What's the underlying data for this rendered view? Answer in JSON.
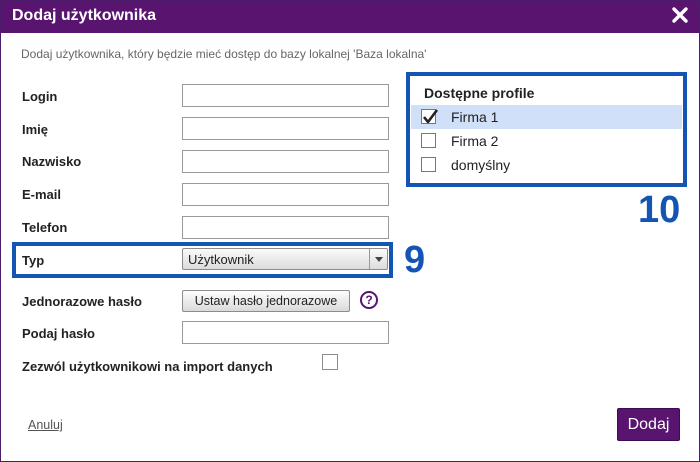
{
  "dialog": {
    "title": "Dodaj użytkownika",
    "close_icon": "close-icon",
    "description": "Dodaj użytkownika, który będzie mieć dostęp do bazy lokalnej 'Baza lokalna'"
  },
  "form": {
    "login_label": "Login",
    "login_value": "",
    "first_name_label": "Imię",
    "first_name_value": "",
    "last_name_label": "Nazwisko",
    "last_name_value": "",
    "email_label": "E-mail",
    "email_value": "",
    "phone_label": "Telefon",
    "phone_value": "",
    "type_label": "Typ",
    "type_value": "Użytkownik",
    "one_time_password_label": "Jednorazowe hasło",
    "one_time_password_button": "Ustaw hasło jednorazowe",
    "help_symbol": "?",
    "password_label": "Podaj hasło",
    "password_value": "",
    "allow_import_label": "Zezwól użytkownikowi na import danych",
    "allow_import_checked": false
  },
  "profiles": {
    "title": "Dostępne profile",
    "items": [
      {
        "label": "Firma 1",
        "checked": true,
        "selected": true
      },
      {
        "label": "Firma 2",
        "checked": false,
        "selected": false
      },
      {
        "label": "domyślny",
        "checked": false,
        "selected": false
      }
    ]
  },
  "annotations": {
    "type_marker": "9",
    "profiles_marker": "10"
  },
  "footer": {
    "cancel_label": "Anuluj",
    "add_label": "Dodaj"
  },
  "colors": {
    "header": "#58146f",
    "annotation": "#1455b4",
    "selected_row": "#cfe0f8"
  }
}
